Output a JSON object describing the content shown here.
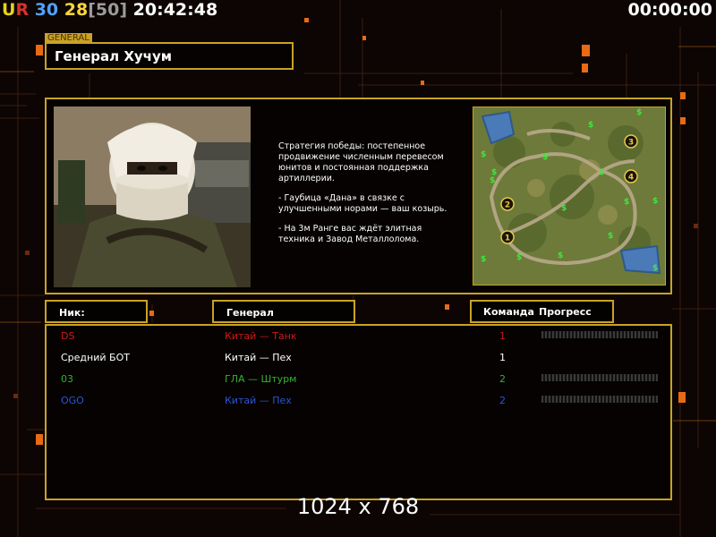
{
  "hud": {
    "label_ur": "UR",
    "num_a": "30",
    "num_b": "28",
    "bracket": "[50]",
    "clock": "20:42:48",
    "timer": "00:00:00",
    "colors": {
      "ur_u": "#e6d31e",
      "ur_r": "#d4342a",
      "num_a": "#4fa3ff",
      "num_b": "#ffd43a",
      "bracket": "#9b9b9b"
    }
  },
  "general": {
    "tag": "GENERAL",
    "name": "Генерал Хучум",
    "strategy_lines": [
      "Стратегия победы: постепенное продвижение численным перевесом юнитов и постоянная поддержка артиллерии.",
      "- Гаубица «Дана» в связке с улучшенными норами — ваш козырь.",
      "- На 3м Ранге вас ждёт элитная техника и Завод Металлолома."
    ]
  },
  "minimap": {
    "start_markers": [
      "1",
      "2",
      "3",
      "4"
    ],
    "resource_icon": "dollar-icon"
  },
  "table": {
    "headers": {
      "nick": "Ник:",
      "general": "Генерал",
      "team": "Команда",
      "progress": "Прогресс"
    },
    "players": [
      {
        "nick": "DS",
        "general": "Китай — Танк",
        "team": "1",
        "color": "#d01818",
        "show_progress": true
      },
      {
        "nick": "Средний БОТ",
        "general": "Китай — Пех",
        "team": "1",
        "color": "#ffffff",
        "show_progress": false
      },
      {
        "nick": "03",
        "general": "ГЛА — Штурм",
        "team": "2",
        "color": "#2fb52f",
        "show_progress": true
      },
      {
        "nick": "OGO",
        "general": "Китай — Пех",
        "team": "2",
        "color": "#2c55d8",
        "show_progress": true
      }
    ]
  },
  "resolution": "1024 x 768",
  "accent_color": "#c9a227"
}
